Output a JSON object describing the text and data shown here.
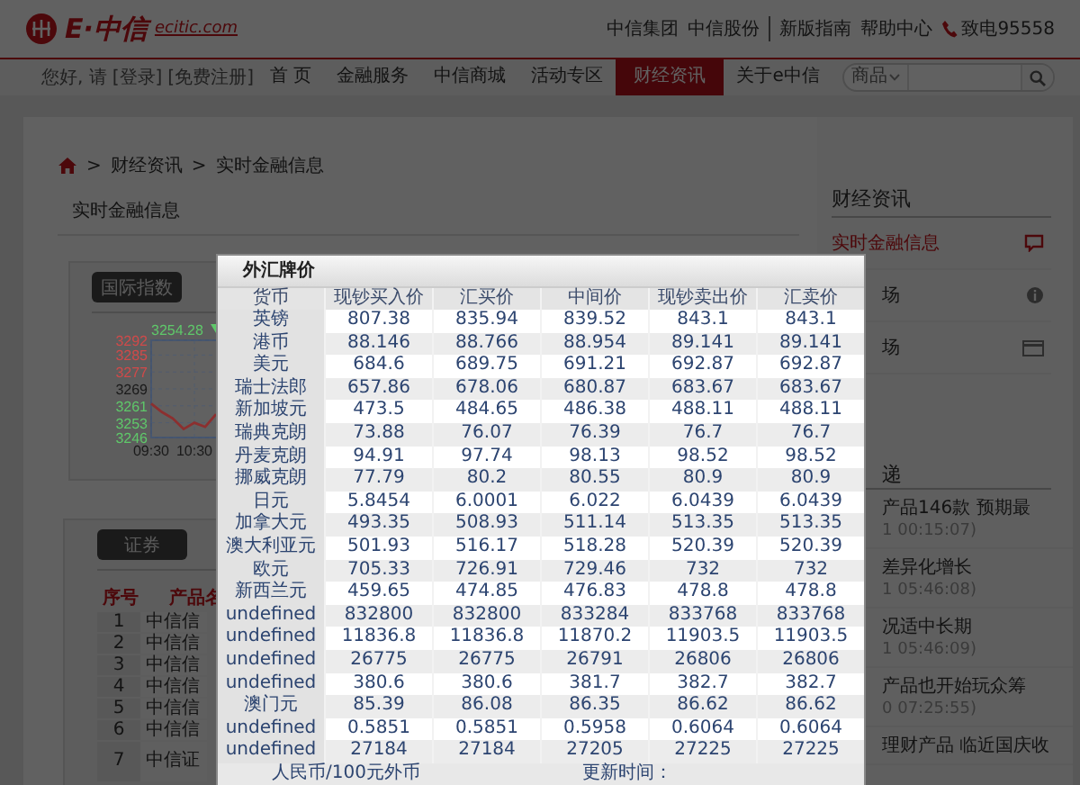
{
  "header": {
    "logo": {
      "brand": "E·中信",
      "domain": "ecitic.com"
    },
    "top_links": [
      {
        "label": "中信集团"
      },
      {
        "label": "中信股份"
      },
      {
        "label": "新版指南"
      },
      {
        "label": "帮助中心"
      }
    ],
    "hotline": "致电95558"
  },
  "nav": {
    "greeting": "您好, 请",
    "login": "[登录]",
    "register": "[免费注册]",
    "items": [
      {
        "label": "首 页",
        "selected": false
      },
      {
        "label": "金融服务",
        "selected": false
      },
      {
        "label": "中信商城",
        "selected": false
      },
      {
        "label": "活动专区",
        "selected": false
      },
      {
        "label": "财经资讯",
        "selected": true
      },
      {
        "label": "关于e中信",
        "selected": false
      }
    ],
    "search": {
      "category": "商品"
    }
  },
  "breadcrumb": [
    {
      "sep": ">",
      "label": "财经资讯"
    },
    {
      "sep": ">",
      "label": "实时金融信息"
    }
  ],
  "page_title": "实时金融信息",
  "index_card": {
    "tab": "国际指数",
    "current": "3254.28",
    "falling": true,
    "chart_data": {
      "type": "line",
      "grid": true,
      "x": [
        9.5,
        9.75,
        10,
        10.25,
        10.5,
        10.75,
        11
      ],
      "xlim": [
        9.5,
        15
      ],
      "xticks": [
        {
          "value": 9.5,
          "label": "09:30"
        },
        {
          "value": 10.5,
          "label": "10:30"
        }
      ],
      "ylim": [
        3246,
        3292
      ],
      "yticks": [
        {
          "value": 3292,
          "label": "3292"
        },
        {
          "value": 3285,
          "label": "3285"
        },
        {
          "value": 3277,
          "label": "3277"
        },
        {
          "value": 3269,
          "label": "3269"
        },
        {
          "value": 3261,
          "label": "3261"
        },
        {
          "value": 3253,
          "label": "3253"
        },
        {
          "value": 3246,
          "label": "3246"
        }
      ],
      "series": [
        {
          "color": "#8c2f2f",
          "values": [
            3262,
            3258,
            3255,
            3250,
            3253,
            3251,
            3257
          ]
        }
      ]
    }
  },
  "securities_card": {
    "tab": "证券",
    "columns": [
      "序号",
      "产品名"
    ],
    "rows": [
      {
        "no": "1",
        "product": "中信信"
      },
      {
        "no": "2",
        "product": "中信信"
      },
      {
        "no": "3",
        "product": "中信信"
      },
      {
        "no": "4",
        "product": "中信信"
      },
      {
        "no": "5",
        "product": "中信信"
      },
      {
        "no": "6",
        "product": "中信信"
      },
      {
        "no": "7",
        "product": "中信证"
      }
    ]
  },
  "sidebar": {
    "heading": "财经资讯",
    "menu": [
      {
        "label": "实时金融信息",
        "selected": true
      },
      {
        "label": "场",
        "selected": false
      },
      {
        "label": "场",
        "selected": false
      }
    ],
    "news_heading": "递",
    "news": [
      {
        "title": "产品146款 预期最",
        "time": "1 00:15:07)"
      },
      {
        "title": "差异化增长",
        "time": "1 05:46:08)"
      },
      {
        "title": "况适中长期",
        "time": "1 05:46:09)"
      },
      {
        "title": "产品也开始玩众筹",
        "time": "0 07:25:55)"
      },
      {
        "title": "理财产品 临近国庆收"
      }
    ]
  },
  "forex_modal": {
    "title": "外汇牌价",
    "columns": [
      "货币",
      "现钞买入价",
      "汇买价",
      "中间价",
      "现钞卖出价",
      "汇卖价"
    ],
    "rows": [
      [
        "英镑",
        "807.38",
        "835.94",
        "839.52",
        "843.1",
        "843.1"
      ],
      [
        "港币",
        "88.146",
        "88.766",
        "88.954",
        "89.141",
        "89.141"
      ],
      [
        "美元",
        "684.6",
        "689.75",
        "691.21",
        "692.87",
        "692.87"
      ],
      [
        "瑞士法郎",
        "657.86",
        "678.06",
        "680.87",
        "683.67",
        "683.67"
      ],
      [
        "新加坡元",
        "473.5",
        "484.65",
        "486.38",
        "488.11",
        "488.11"
      ],
      [
        "瑞典克朗",
        "73.88",
        "76.07",
        "76.39",
        "76.7",
        "76.7"
      ],
      [
        "丹麦克朗",
        "94.91",
        "97.74",
        "98.13",
        "98.52",
        "98.52"
      ],
      [
        "挪威克朗",
        "77.79",
        "80.2",
        "80.55",
        "80.9",
        "80.9"
      ],
      [
        "日元",
        "5.8454",
        "6.0001",
        "6.022",
        "6.0439",
        "6.0439"
      ],
      [
        "加拿大元",
        "493.35",
        "508.93",
        "511.14",
        "513.35",
        "513.35"
      ],
      [
        "澳大利亚元",
        "501.93",
        "516.17",
        "518.28",
        "520.39",
        "520.39"
      ],
      [
        "欧元",
        "705.33",
        "726.91",
        "729.46",
        "732",
        "732"
      ],
      [
        "新西兰元",
        "459.65",
        "474.85",
        "476.83",
        "478.8",
        "478.8"
      ],
      [
        "undefined",
        "832800",
        "832800",
        "833284",
        "833768",
        "833768"
      ],
      [
        "undefined",
        "11836.8",
        "11836.8",
        "11870.2",
        "11903.5",
        "11903.5"
      ],
      [
        "undefined",
        "26775",
        "26775",
        "26791",
        "26806",
        "26806"
      ],
      [
        "undefined",
        "380.6",
        "380.6",
        "381.7",
        "382.7",
        "382.7"
      ],
      [
        "澳门元",
        "85.39",
        "86.08",
        "86.35",
        "86.62",
        "86.62"
      ],
      [
        "undefined",
        "0.5851",
        "0.5851",
        "0.5958",
        "0.6064",
        "0.6064"
      ],
      [
        "undefined",
        "27184",
        "27184",
        "27205",
        "27225",
        "27225"
      ]
    ],
    "footer": {
      "unit": "人民币/100元外币",
      "updated_label": "更新时间："
    }
  }
}
